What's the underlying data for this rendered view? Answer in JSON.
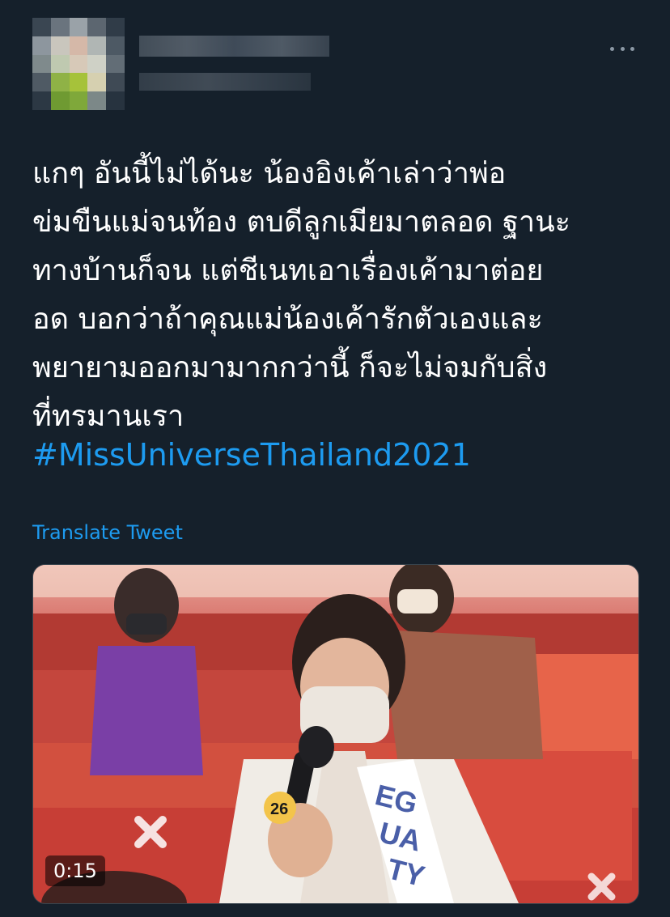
{
  "tweet": {
    "text_lines": [
      "แกๆ อันนี้ไม่ได้นะ น้องอิงเค้าเล่าว่าพ่อ",
      "ข่มขืนแม่จนท้อง ตบดีลูกเมียมาตลอด ฐานะ",
      "ทางบ้านก็จน แต่ชีเนทเอาเรื่องเค้ามาต่อย",
      "อด บอกว่าถ้าคุณแม่น้องเค้ารักตัวเองและ",
      "พยายามออกมามากกว่านี้ ก็จะไม่จมกับสิ่ง",
      "ที่ทรมานเรา"
    ],
    "hashtag": "#MissUniverseThailand2021",
    "translate_label": "Translate Tweet"
  },
  "media": {
    "duration": "0:15",
    "sash_number": "26"
  },
  "icons": {
    "more": "more-horizontal-icon"
  },
  "colors": {
    "background": "#15202b",
    "link": "#1d9bf0",
    "text": "#ffffff",
    "muted": "#8b98a5"
  }
}
